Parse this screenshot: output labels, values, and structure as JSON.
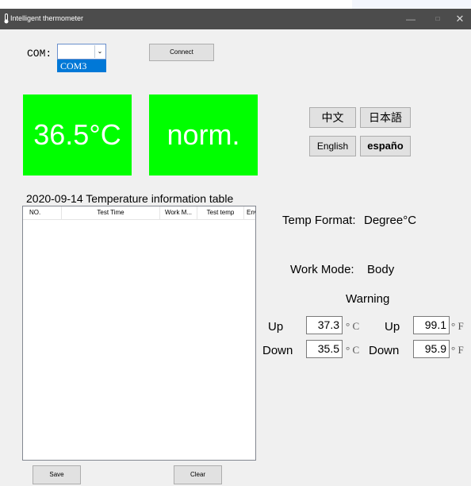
{
  "window": {
    "title": "Intelligent thermometer",
    "controls": {
      "minimize": "—",
      "maximize": "□",
      "close": "✕"
    }
  },
  "com": {
    "label": "COM:",
    "selected": "",
    "options": [
      "COM3"
    ],
    "highlighted": "COM3"
  },
  "connect_label": "Connect",
  "display": {
    "temperature": "36.5°C",
    "status": "norm.",
    "tile_color": "#00ff00"
  },
  "languages": {
    "zh": "中文",
    "ja": "日本語",
    "en": "English",
    "es": "españo"
  },
  "table": {
    "title": "2020-09-14 Temperature information table",
    "columns": [
      "NO.",
      "Test Time",
      "Work M...",
      "Test temp",
      "Environme"
    ],
    "rows": []
  },
  "info": {
    "format_label": "Temp Format:",
    "format_value": "Degree°C",
    "mode_label": "Work Mode:",
    "mode_value": "Body"
  },
  "warning": {
    "title": "Warning",
    "up_label": "Up",
    "down_label": "Down",
    "up_c": "37.3",
    "down_c": "35.5",
    "up_f": "99.1",
    "down_f": "95.9",
    "unit_c": "° C",
    "unit_f": "° F"
  },
  "buttons": {
    "save": "Save",
    "clear": "Clear"
  },
  "icons": {
    "app": "thermometer-icon",
    "dropdown": "chevron-down-icon"
  }
}
